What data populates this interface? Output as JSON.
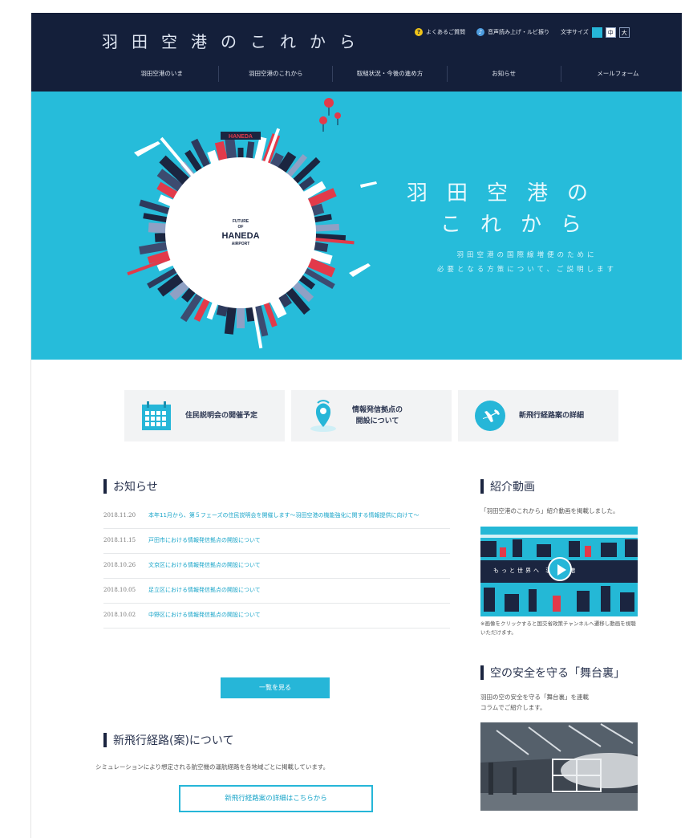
{
  "header": {
    "site_title": "羽田空港のこれから",
    "util": {
      "faq": "よくあるご質問",
      "voice": "音声読み上げ・ルビ振り",
      "text_size_label": "文字サイズ",
      "size_small": "小",
      "size_mid": "中",
      "size_large": "大"
    },
    "nav": [
      "羽田空港のいま",
      "羽田空港のこれから",
      "取組状況・今後の進め方",
      "お知らせ",
      "メールフォーム"
    ]
  },
  "hero": {
    "title_line1": "羽田空港の",
    "title_line2": "これから",
    "subtitle_line1": "羽田空港の国際線増便のために",
    "subtitle_line2": "必要となる方策について、ご説明します",
    "logo_line1": "FUTURE",
    "logo_line2": "OF",
    "logo_line3": "HANEDA",
    "logo_line4": "AIRPORT",
    "sign_text": "HANEDA"
  },
  "quick_links": [
    {
      "label": "住民説明会の開催予定",
      "icon": "calendar-icon"
    },
    {
      "label_line1": "情報発信拠点の",
      "label_line2": "開設について",
      "icon": "location-pin-icon"
    },
    {
      "label": "新飛行経路案の詳細",
      "icon": "airplane-icon"
    }
  ],
  "news": {
    "heading": "お知らせ",
    "items": [
      {
        "date": "2018.11.20",
        "title": "本年11月から、第５フェーズの住民説明会を開催します～羽田空港の機能強化に関する情報提供に向けて～"
      },
      {
        "date": "2018.11.15",
        "title": "戸田市における情報発信拠点の開設について"
      },
      {
        "date": "2018.10.26",
        "title": "文京区における情報発信拠点の開設について"
      },
      {
        "date": "2018.10.05",
        "title": "足立区における情報発信拠点の開設について"
      },
      {
        "date": "2018.10.02",
        "title": "中野区における情報発信拠点の開設について"
      }
    ],
    "more_button": "一覧を見る"
  },
  "route": {
    "heading": "新飛行経路(案)について",
    "desc": "シミュレーションにより想定される航空機の運航経路を各地域ごとに掲載しています。",
    "button": "新飛行経路案の詳細はこちらから"
  },
  "sidebar": {
    "video_heading": "紹介動画",
    "video_desc": "「羽田空港のこれから」紹介動画を掲載しました。",
    "video_banner": "もっと世界へ 羽田空港",
    "video_note": "※画像をクリックすると国交省政策チャンネルへ遷移し動画を視聴いただけます。",
    "backstage_heading": "空の安全を守る「舞台裏」",
    "backstage_desc_line1": "羽田の空の安全を守る「舞台裏」を連載",
    "backstage_desc_line2": "コラムでご紹介します。"
  },
  "colors": {
    "navy": "#141f3a",
    "cyan": "#26bcda",
    "link": "#1aa5c9"
  }
}
